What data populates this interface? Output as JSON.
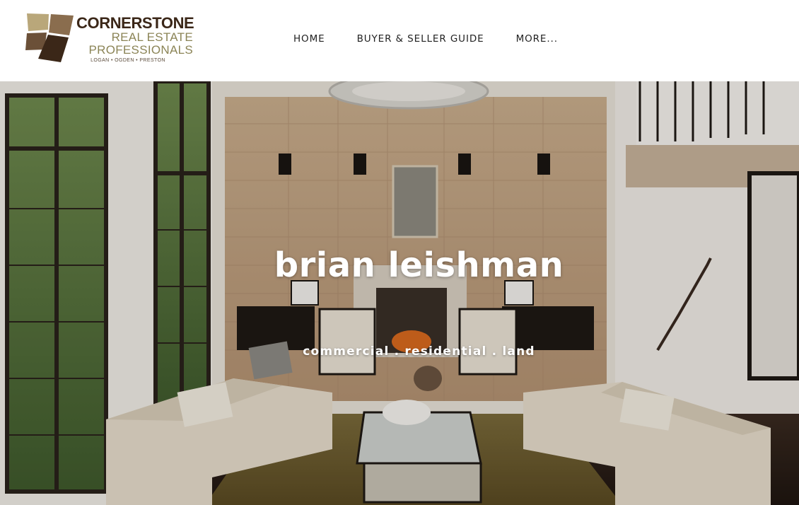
{
  "header": {
    "logo": {
      "name_line1": "CORNERSTONE",
      "name_line2": "REAL ESTATE",
      "name_line3": "PROFESSIONALS",
      "locations": "LOGAN • OGDEN • PRESTON",
      "colors": {
        "dark_brown": "#3b2718",
        "tan": "#8b8456",
        "light_tan": "#b9a77a"
      }
    },
    "nav": [
      {
        "label": "HOME"
      },
      {
        "label": "BUYER & SELLER GUIDE"
      },
      {
        "label": "MORE..."
      }
    ]
  },
  "hero": {
    "title": "brian leishman",
    "subtitle": "commercial . residential . land",
    "background_image": "living-room-photo"
  }
}
